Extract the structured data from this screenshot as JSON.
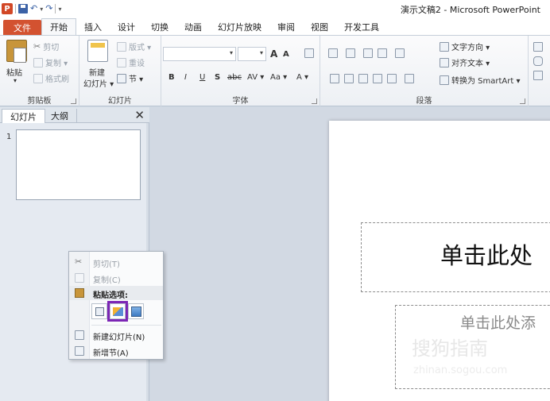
{
  "window": {
    "title": "演示文稿2 - Microsoft PowerPoint",
    "app_icon_letter": "P"
  },
  "quick_access": {
    "undo": "↶",
    "redo": "↷",
    "dropdown": "▾"
  },
  "tabs": [
    {
      "label": "文件",
      "type": "file"
    },
    {
      "label": "开始",
      "type": "active"
    },
    {
      "label": "插入"
    },
    {
      "label": "设计"
    },
    {
      "label": "切换"
    },
    {
      "label": "动画"
    },
    {
      "label": "幻灯片放映"
    },
    {
      "label": "审阅"
    },
    {
      "label": "视图"
    },
    {
      "label": "开发工具"
    }
  ],
  "ribbon": {
    "clipboard": {
      "label": "剪贴板",
      "paste": "粘贴",
      "paste_arrow": "▾",
      "cut": "剪切",
      "copy": "复制 ▾",
      "format_painter": "格式刷"
    },
    "slides": {
      "label": "幻灯片",
      "new_slide_line1": "新建",
      "new_slide_line2": "幻灯片 ▾",
      "layout": "版式 ▾",
      "reset": "重设",
      "section": "节 ▾"
    },
    "font": {
      "label": "字体",
      "bold": "B",
      "italic": "I",
      "underline": "U",
      "shadow": "S",
      "strike": "abc",
      "spacing": "AV ▾",
      "case": "Aa ▾",
      "color": "A ▾",
      "grow": "A",
      "shrink": "A"
    },
    "paragraph": {
      "label": "段落",
      "text_direction": "文字方向 ▾",
      "align_text": "对齐文本 ▾",
      "smartart": "转换为 SmartArt ▾"
    }
  },
  "panel": {
    "tab_slides": "幻灯片",
    "tab_outline": "大纲",
    "close": "✕",
    "slide_number": "1"
  },
  "slide": {
    "title_placeholder": "单击此处",
    "subtitle_placeholder": "单击此处添",
    "watermark_logo": "搜狗指南",
    "watermark_url": "zhinan.sogou.com"
  },
  "context_menu": {
    "cut": "剪切(T)",
    "copy": "复制(C)",
    "paste_options": "粘贴选项:",
    "new_slide": "新建幻灯片(N)",
    "new_section": "新增节(A)"
  }
}
